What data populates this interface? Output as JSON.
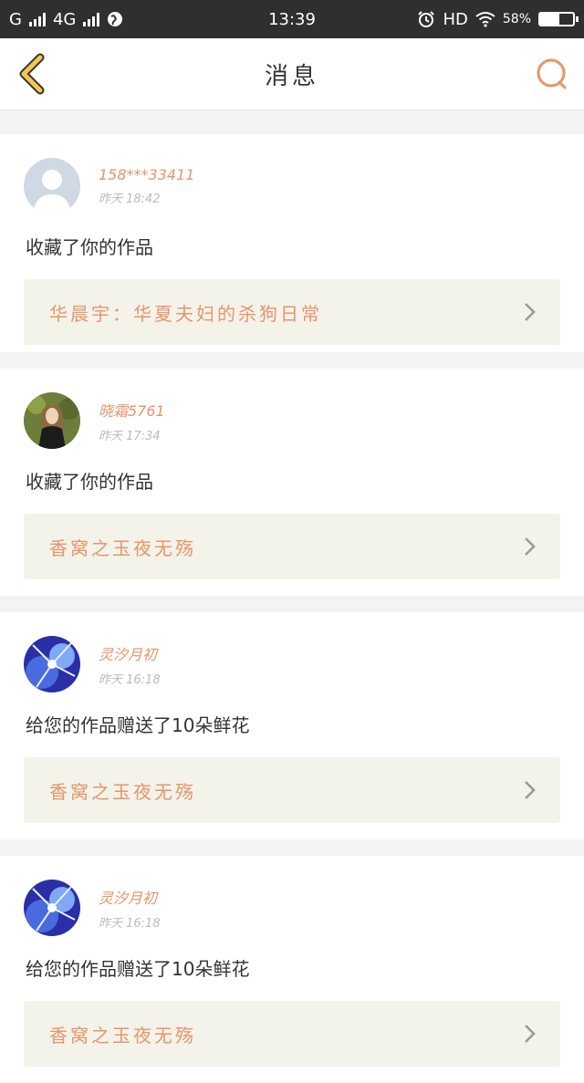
{
  "status_bar": {
    "carrier_1": "G",
    "carrier_2": "4G",
    "time": "13:39",
    "network": "HD",
    "battery": "58%"
  },
  "nav": {
    "title": "消息"
  },
  "messages": [
    {
      "name": "158***33411",
      "time": "昨天 18:42",
      "action": "收藏了你的作品",
      "work": "华晨宇：华夏夫妇的杀狗日常",
      "avatar": "default-avatar"
    },
    {
      "name": "晓霜5761",
      "time": "昨天 17:34",
      "action": "收藏了你的作品",
      "work": "香窝之玉夜无殇",
      "avatar": "photo-avatar"
    },
    {
      "name": "灵汐月初",
      "time": "昨天 16:18",
      "action": "给您的作品赠送了10朵鲜花",
      "work": "香窝之玉夜无殇",
      "avatar": "blue-art-avatar"
    },
    {
      "name": "灵汐月初",
      "time": "昨天 16:18",
      "action": "给您的作品赠送了10朵鲜花",
      "work": "香窝之玉夜无殇",
      "avatar": "blue-art-avatar"
    }
  ],
  "colors": {
    "accent": "#e8956a",
    "back_icon": "#f2c94c"
  }
}
